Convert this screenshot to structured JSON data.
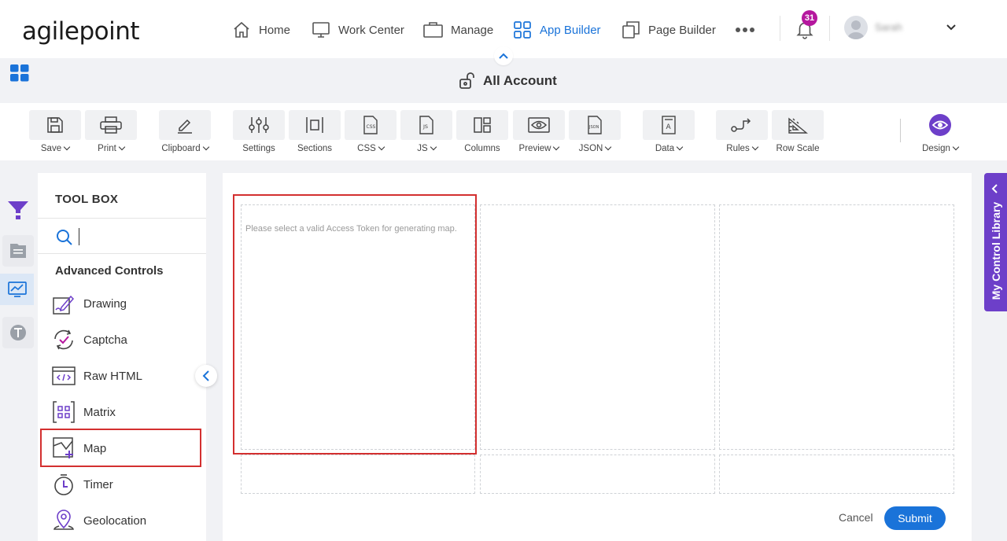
{
  "nav": {
    "logo": "agilepoint",
    "items": [
      {
        "label": "Home",
        "icon": "home-icon"
      },
      {
        "label": "Work Center",
        "icon": "monitor-icon"
      },
      {
        "label": "Manage",
        "icon": "briefcase-icon"
      },
      {
        "label": "App Builder",
        "icon": "app-grid-icon",
        "active": true
      },
      {
        "label": "Page Builder",
        "icon": "pages-icon"
      }
    ],
    "more_icon": "more-dots-icon",
    "notifications": {
      "count": "31",
      "icon": "bell-icon"
    },
    "user": {
      "name": "Sarah",
      "avatar": "avatar-icon"
    }
  },
  "header": {
    "title": "All Account",
    "title_icon": "unlock-icon",
    "apps_icon": "apps-grid-icon"
  },
  "toolbar": {
    "save": "Save",
    "print": "Print",
    "clipboard": "Clipboard",
    "settings": "Settings",
    "sections": "Sections",
    "css": "CSS",
    "js": "JS",
    "columns": "Columns",
    "preview": "Preview",
    "json": "JSON",
    "data": "Data",
    "rules": "Rules",
    "row_scale": "Row Scale",
    "design": "Design"
  },
  "toolbox": {
    "title": "TOOL BOX",
    "search_value": "",
    "category": "Advanced Controls",
    "controls": [
      {
        "label": "Drawing",
        "icon": "drawing-icon"
      },
      {
        "label": "Captcha",
        "icon": "captcha-icon"
      },
      {
        "label": "Raw HTML",
        "icon": "html-icon"
      },
      {
        "label": "Matrix",
        "icon": "matrix-icon"
      },
      {
        "label": "Map",
        "icon": "map-icon",
        "highlighted": true
      },
      {
        "label": "Timer",
        "icon": "timer-icon"
      },
      {
        "label": "Geolocation",
        "icon": "geolocation-icon"
      }
    ]
  },
  "canvas": {
    "map_message": "Please select a valid Access Token for generating map.",
    "cancel_label": "Cancel",
    "submit_label": "Submit"
  },
  "side_library": {
    "label": "My Control Library"
  },
  "colors": {
    "accent": "#1a73d9",
    "purple": "#6d3fc9",
    "highlight": "#d32f2f",
    "badge": "#b5179e"
  }
}
